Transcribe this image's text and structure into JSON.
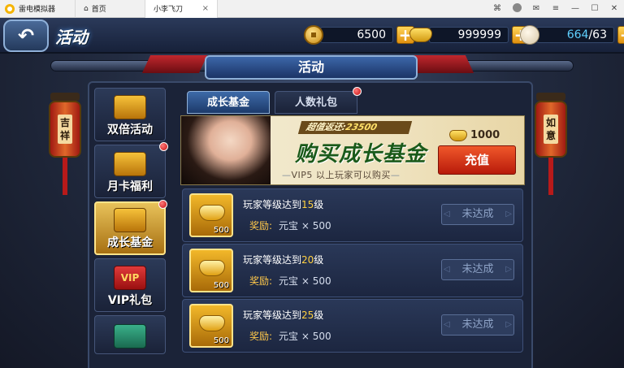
{
  "emulator": {
    "app_name": "雷电模拟器",
    "tabs": [
      {
        "label": "首页",
        "active": false
      },
      {
        "label": "小李飞刀",
        "active": true
      }
    ],
    "close_glyph": "×"
  },
  "header": {
    "title": "活动",
    "copper": "6500",
    "ingots": "999999",
    "stamina_current": "664",
    "stamina_max": "/63"
  },
  "panel": {
    "title": "活动",
    "lantern_left": "吉祥",
    "lantern_right": "如意"
  },
  "nav": [
    {
      "label": "双倍活动",
      "active": false,
      "badge": false,
      "icon": "treasure-chest-icon"
    },
    {
      "label": "月卡福利",
      "active": false,
      "badge": true,
      "icon": "treasure-chest-icon"
    },
    {
      "label": "成长基金",
      "active": true,
      "badge": true,
      "icon": "money-tree-icon"
    },
    {
      "label": "VIP礼包",
      "active": false,
      "badge": false,
      "icon": "vip-gift-icon"
    },
    {
      "label": "",
      "active": false,
      "badge": false,
      "icon": "green-chest-icon"
    }
  ],
  "subtabs": [
    {
      "label": "成长基金",
      "active": true
    },
    {
      "label": "人数礼包",
      "active": false,
      "badge": true
    }
  ],
  "promo": {
    "rebate_label": "超值返还:",
    "rebate_value": "23500",
    "headline": "购买成长基金",
    "subline": "VIP5 以上玩家可以购买",
    "price": "1000",
    "button": "充值"
  },
  "tasks": [
    {
      "prefix": "玩家等级达到",
      "level": "15",
      "suffix": "级",
      "reward_label": "奖励:",
      "reward": "元宝 × 500",
      "qty": "500",
      "button": "未达成"
    },
    {
      "prefix": "玩家等级达到",
      "level": "20",
      "suffix": "级",
      "reward_label": "奖励:",
      "reward": "元宝 × 500",
      "qty": "500",
      "button": "未达成"
    },
    {
      "prefix": "玩家等级达到",
      "level": "25",
      "suffix": "级",
      "reward_label": "奖励:",
      "reward": "元宝 × 500",
      "qty": "500",
      "button": "未达成"
    }
  ]
}
